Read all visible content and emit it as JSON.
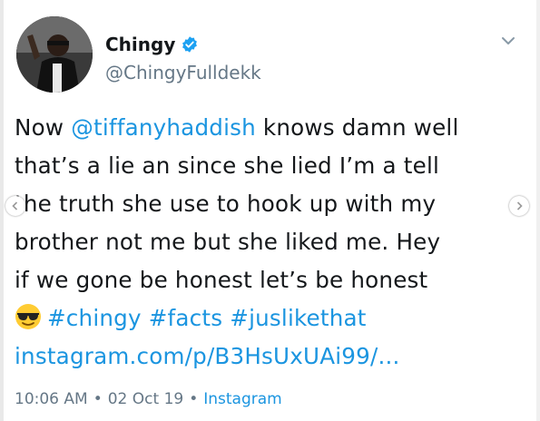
{
  "author": {
    "name": "Chingy",
    "handle": "@ChingyFulldekk",
    "verified": true,
    "avatar_icon": "profile-photo"
  },
  "tweet": {
    "line1_pre": "Now ",
    "mention": "@tiffanyhaddish",
    "line1_post": " knows damn well",
    "line2": "that’s a lie an since she lied I’m a tell",
    "line3": "the truth she use to hook up with my",
    "line4": "brother not me but she liked me. Hey",
    "line5": "if we gone be honest let’s be honest",
    "emoji": "sunglasses-emoji",
    "hashtags": [
      "#chingy",
      "#facts",
      "#juslikethat"
    ],
    "link": "instagram.com/p/B3HsUxUAi99/..."
  },
  "meta": {
    "time": "10:06 AM",
    "date": "02 Oct 19",
    "separator": "•",
    "source": "Instagram"
  },
  "colors": {
    "link": "#1b95e0",
    "text": "#14171a",
    "muted": "#657786"
  }
}
